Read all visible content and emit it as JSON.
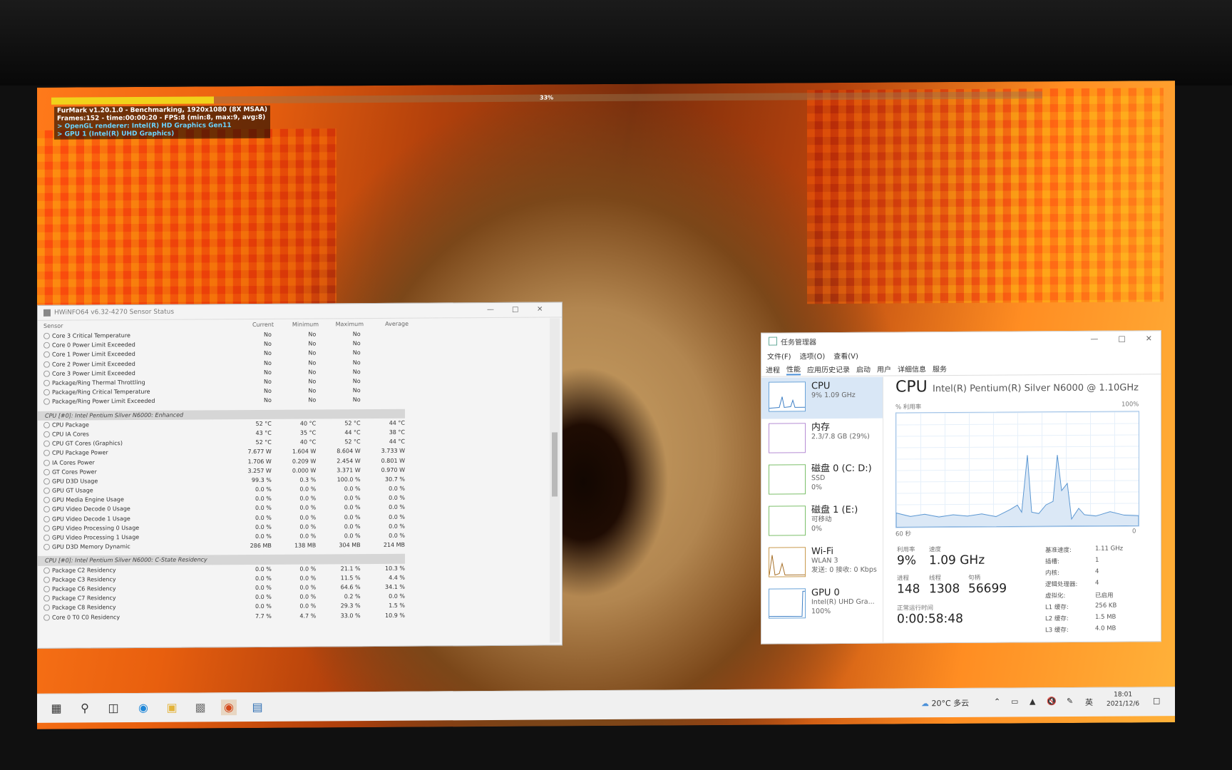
{
  "furmark": {
    "progress_label": "33%",
    "progress_value": 0.33,
    "line1": "FurMark v1.20.1.0 - Benchmarking, 1920x1080 (8X MSAA)",
    "line2": "Frames:152 - time:00:00:20 - FPS:8 (min:8, max:9, avg:8)",
    "line3": "> OpenGL renderer: Intel(R) HD Graphics Gen11",
    "line4": "> GPU 1 (Intel(R) UHD Graphics)"
  },
  "hwinfo": {
    "title": "HWiNFO64 v6.32-4270 Sensor Status",
    "columns": [
      "Sensor",
      "Current",
      "Minimum",
      "Maximum",
      "Average"
    ],
    "rows": [
      {
        "name": "Core 3 Critical Temperature",
        "cur": "No",
        "min": "No",
        "max": "No",
        "avg": ""
      },
      {
        "name": "Core 0 Power Limit Exceeded",
        "cur": "No",
        "min": "No",
        "max": "No",
        "avg": ""
      },
      {
        "name": "Core 1 Power Limit Exceeded",
        "cur": "No",
        "min": "No",
        "max": "No",
        "avg": ""
      },
      {
        "name": "Core 2 Power Limit Exceeded",
        "cur": "No",
        "min": "No",
        "max": "No",
        "avg": ""
      },
      {
        "name": "Core 3 Power Limit Exceeded",
        "cur": "No",
        "min": "No",
        "max": "No",
        "avg": ""
      },
      {
        "name": "Package/Ring Thermal Throttling",
        "cur": "No",
        "min": "No",
        "max": "No",
        "avg": ""
      },
      {
        "name": "Package/Ring Critical Temperature",
        "cur": "No",
        "min": "No",
        "max": "No",
        "avg": ""
      },
      {
        "name": "Package/Ring Power Limit Exceeded",
        "cur": "No",
        "min": "No",
        "max": "No",
        "avg": ""
      }
    ],
    "group1": "CPU [#0]: Intel Pentium Silver N6000: Enhanced",
    "rows2": [
      {
        "name": "CPU Package",
        "cur": "52 °C",
        "min": "40 °C",
        "max": "52 °C",
        "avg": "44 °C"
      },
      {
        "name": "CPU IA Cores",
        "cur": "43 °C",
        "min": "35 °C",
        "max": "44 °C",
        "avg": "38 °C"
      },
      {
        "name": "CPU GT Cores (Graphics)",
        "cur": "52 °C",
        "min": "40 °C",
        "max": "52 °C",
        "avg": "44 °C"
      },
      {
        "name": "CPU Package Power",
        "cur": "7.677 W",
        "min": "1.604 W",
        "max": "8.604 W",
        "avg": "3.733 W"
      },
      {
        "name": "IA Cores Power",
        "cur": "1.706 W",
        "min": "0.209 W",
        "max": "2.454 W",
        "avg": "0.801 W"
      },
      {
        "name": "GT Cores Power",
        "cur": "3.257 W",
        "min": "0.000 W",
        "max": "3.371 W",
        "avg": "0.970 W"
      },
      {
        "name": "GPU D3D Usage",
        "cur": "99.3 %",
        "min": "0.3 %",
        "max": "100.0 %",
        "avg": "30.7 %"
      },
      {
        "name": "GPU GT Usage",
        "cur": "0.0 %",
        "min": "0.0 %",
        "max": "0.0 %",
        "avg": "0.0 %"
      },
      {
        "name": "GPU Media Engine Usage",
        "cur": "0.0 %",
        "min": "0.0 %",
        "max": "0.0 %",
        "avg": "0.0 %"
      },
      {
        "name": "GPU Video Decode 0 Usage",
        "cur": "0.0 %",
        "min": "0.0 %",
        "max": "0.0 %",
        "avg": "0.0 %"
      },
      {
        "name": "GPU Video Decode 1 Usage",
        "cur": "0.0 %",
        "min": "0.0 %",
        "max": "0.0 %",
        "avg": "0.0 %"
      },
      {
        "name": "GPU Video Processing 0 Usage",
        "cur": "0.0 %",
        "min": "0.0 %",
        "max": "0.0 %",
        "avg": "0.0 %"
      },
      {
        "name": "GPU Video Processing 1 Usage",
        "cur": "0.0 %",
        "min": "0.0 %",
        "max": "0.0 %",
        "avg": "0.0 %"
      },
      {
        "name": "GPU D3D Memory Dynamic",
        "cur": "286 MB",
        "min": "138 MB",
        "max": "304 MB",
        "avg": "214 MB"
      }
    ],
    "group2": "CPU [#0]: Intel Pentium Silver N6000: C-State Residency",
    "rows3": [
      {
        "name": "Package C2 Residency",
        "cur": "0.0 %",
        "min": "0.0 %",
        "max": "21.1 %",
        "avg": "10.3 %"
      },
      {
        "name": "Package C3 Residency",
        "cur": "0.0 %",
        "min": "0.0 %",
        "max": "11.5 %",
        "avg": "4.4 %"
      },
      {
        "name": "Package C6 Residency",
        "cur": "0.0 %",
        "min": "0.0 %",
        "max": "64.6 %",
        "avg": "34.1 %"
      },
      {
        "name": "Package C7 Residency",
        "cur": "0.0 %",
        "min": "0.0 %",
        "max": "0.2 %",
        "avg": "0.0 %"
      },
      {
        "name": "Package C8 Residency",
        "cur": "0.0 %",
        "min": "0.0 %",
        "max": "29.3 %",
        "avg": "1.5 %"
      },
      {
        "name": "Core 0 T0 C0 Residency",
        "cur": "7.7 %",
        "min": "4.7 %",
        "max": "33.0 %",
        "avg": "10.9 %"
      }
    ]
  },
  "taskmgr": {
    "title": "任务管理器",
    "menu": [
      "文件(F)",
      "选项(O)",
      "查看(V)"
    ],
    "tabs": [
      "进程",
      "性能",
      "应用历史记录",
      "启动",
      "用户",
      "详细信息",
      "服务"
    ],
    "resources": [
      {
        "name": "CPU",
        "sub1": "9% 1.09 GHz",
        "sub2": "",
        "sub3": ""
      },
      {
        "name": "内存",
        "sub1": "2.3/7.8 GB (29%)",
        "sub2": "",
        "sub3": ""
      },
      {
        "name": "磁盘 0 (C: D:)",
        "sub1": "SSD",
        "sub2": "0%",
        "sub3": ""
      },
      {
        "name": "磁盘 1 (E:)",
        "sub1": "可移动",
        "sub2": "0%",
        "sub3": ""
      },
      {
        "name": "Wi-Fi",
        "sub1": "WLAN 3",
        "sub2": "发送: 0 接收: 0 Kbps",
        "sub3": ""
      },
      {
        "name": "GPU 0",
        "sub1": "Intel(R) UHD Gra...",
        "sub2": "100%",
        "sub3": ""
      }
    ],
    "cpu_heading": "CPU",
    "cpu_model": "Intel(R) Pentium(R) Silver N6000 @ 1.10GHz",
    "graph_label_left": "% 利用率",
    "graph_label_right": "100%",
    "graph_time_left": "60 秒",
    "graph_time_right": "0",
    "util_label": "利用率",
    "util_value": "9%",
    "speed_label": "速度",
    "speed_value": "1.09 GHz",
    "proc_label": "进程",
    "proc_value": "148",
    "thread_label": "线程",
    "thread_value": "1308",
    "handle_label": "句柄",
    "handle_value": "56699",
    "uptime_label": "正常运行时间",
    "uptime_value": "0:00:58:48",
    "specs": [
      {
        "k": "基准速度:",
        "v": "1.11 GHz"
      },
      {
        "k": "插槽:",
        "v": "1"
      },
      {
        "k": "内核:",
        "v": "4"
      },
      {
        "k": "逻辑处理器:",
        "v": "4"
      },
      {
        "k": "虚拟化:",
        "v": "已启用"
      },
      {
        "k": "L1 缓存:",
        "v": "256 KB"
      },
      {
        "k": "L2 缓存:",
        "v": "1.5 MB"
      },
      {
        "k": "L3 缓存:",
        "v": "4.0 MB"
      }
    ]
  },
  "taskbar": {
    "weather": "20°C 多云",
    "ime": "英",
    "time": "18:01",
    "date": "2021/12/6"
  }
}
